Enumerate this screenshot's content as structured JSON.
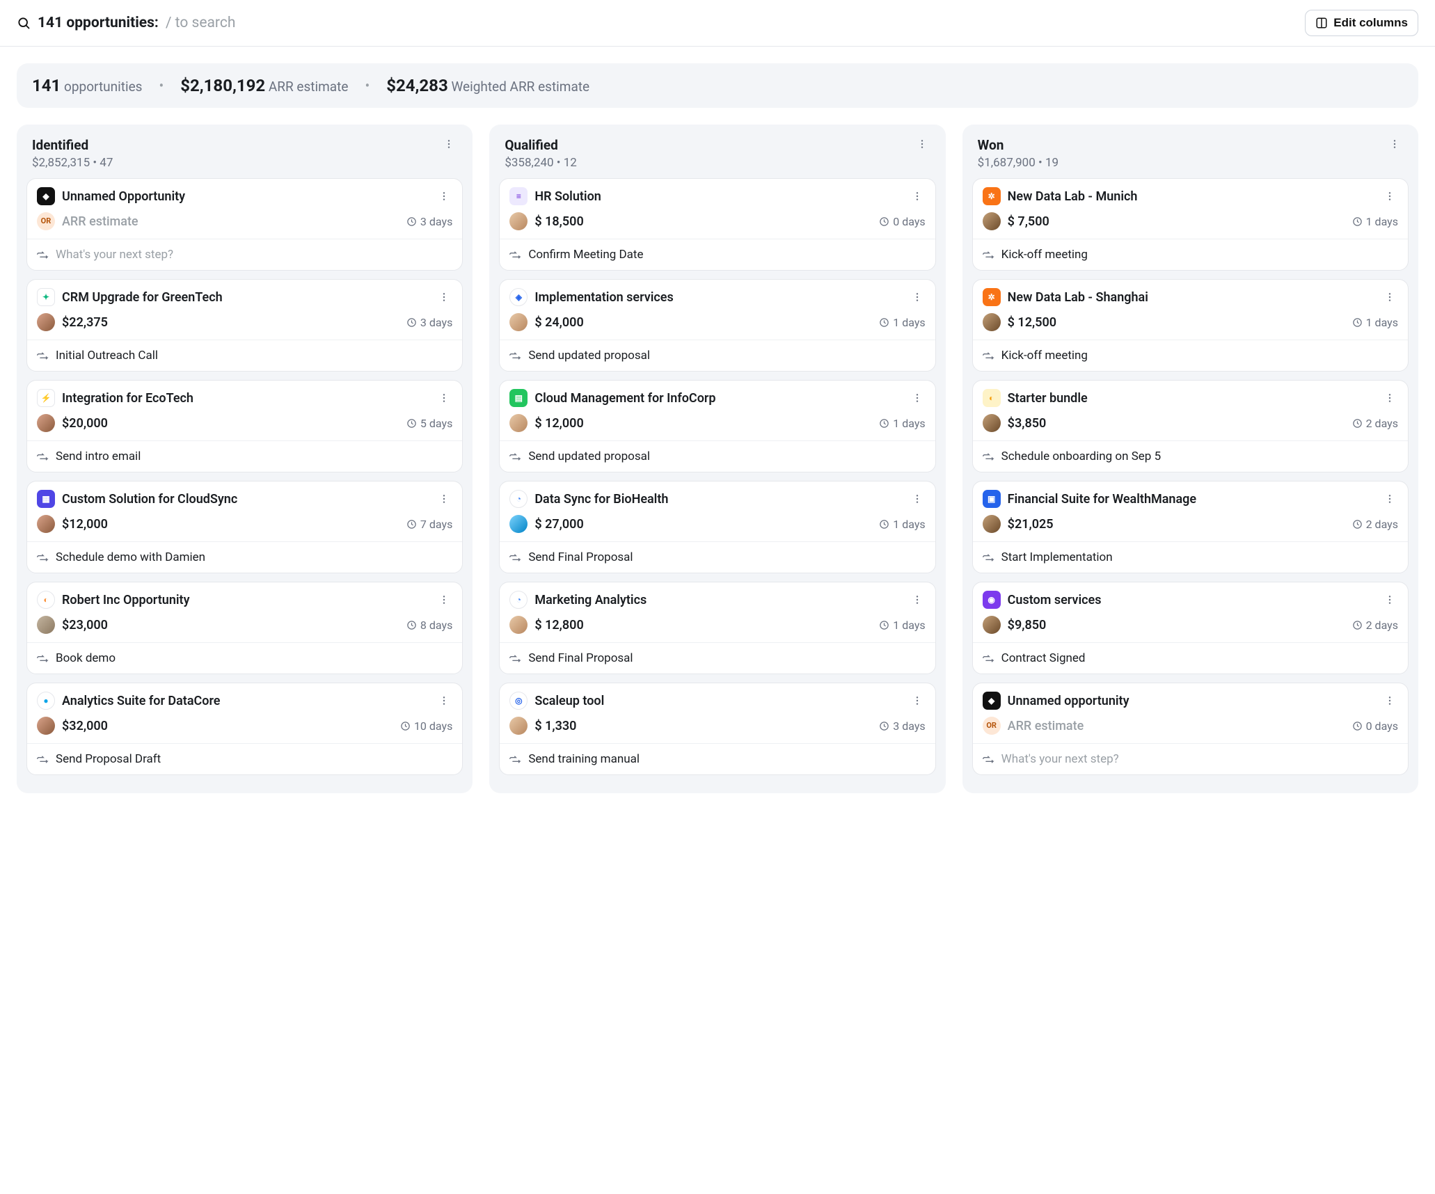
{
  "search": {
    "count_label": "141 opportunities:",
    "hint": "/ to search"
  },
  "edit_columns_label": "Edit columns",
  "stats": {
    "count_value": "141",
    "count_label": "opportunities",
    "arr_value": "$2,180,192",
    "arr_label": "ARR estimate",
    "warr_value": "$24,283",
    "warr_label": "Weighted ARR estimate"
  },
  "columns": [
    {
      "title": "Identified",
      "subtotal": "$2,852,315",
      "count": "47",
      "cards": [
        {
          "logo_bg": "#111111",
          "logo_txt": "◆",
          "logo_round": false,
          "title": "Unnamed Opportunity",
          "avatar": null,
          "or": true,
          "amount": "ARR estimate",
          "amount_ph": true,
          "days": "3 days",
          "next": "What's your next step?",
          "next_ph": true
        },
        {
          "logo_bg": "#ffffff",
          "logo_txt": "✦",
          "logo_fg": "#10b981",
          "logo_round": false,
          "logo_border": true,
          "title": "CRM Upgrade for GreenTech",
          "avatar": "linear-gradient(135deg,#d9a38a,#8b5a3c)",
          "or": false,
          "amount": "$22,375",
          "amount_ph": false,
          "days": "3 days",
          "next": "Initial Outreach Call",
          "next_ph": false
        },
        {
          "logo_bg": "#ffffff",
          "logo_txt": "⚡",
          "logo_fg": "#10b981",
          "logo_round": false,
          "logo_border": true,
          "title": "Integration for EcoTech",
          "avatar": "linear-gradient(135deg,#d9a38a,#8b5a3c)",
          "or": false,
          "amount": "$20,000",
          "amount_ph": false,
          "days": "5 days",
          "next": "Send intro email",
          "next_ph": false
        },
        {
          "logo_bg": "#4f46e5",
          "logo_txt": "▦",
          "logo_round": false,
          "title": "Custom Solution for CloudSync",
          "avatar": "linear-gradient(135deg,#d9a38a,#8b5a3c)",
          "or": false,
          "amount": "$12,000",
          "amount_ph": false,
          "days": "7 days",
          "next": "Schedule demo with Damien",
          "next_ph": false
        },
        {
          "logo_bg": "#ffffff",
          "logo_txt": "◐",
          "logo_fg": "#fb923c",
          "logo_round": true,
          "logo_border": true,
          "title": "Robert Inc Opportunity",
          "avatar": "linear-gradient(135deg,#c4b5a0,#8b7860)",
          "or": false,
          "amount": "$23,000",
          "amount_ph": false,
          "days": "8 days",
          "next": "Book demo",
          "next_ph": false
        },
        {
          "logo_bg": "#ffffff",
          "logo_txt": "●",
          "logo_fg": "#0ea5e9",
          "logo_round": true,
          "logo_border": true,
          "title": "Analytics Suite for DataCore",
          "avatar": "linear-gradient(135deg,#d9a38a,#8b5a3c)",
          "or": false,
          "amount": "$32,000",
          "amount_ph": false,
          "days": "10 days",
          "next": "Send Proposal Draft",
          "next_ph": false
        }
      ]
    },
    {
      "title": "Qualified",
      "subtotal": "$358,240",
      "count": "12",
      "cards": [
        {
          "logo_bg": "#ede9fe",
          "logo_txt": "≡",
          "logo_fg": "#6d28d9",
          "logo_round": false,
          "title": "HR Solution",
          "avatar": "linear-gradient(135deg,#e8c9a8,#b8875f)",
          "or": false,
          "amount": "$ 18,500",
          "amount_ph": false,
          "days": "0 days",
          "next": "Confirm Meeting Date",
          "next_ph": false
        },
        {
          "logo_bg": "#ffffff",
          "logo_txt": "◈",
          "logo_fg": "#2563eb",
          "logo_round": true,
          "logo_border": true,
          "title": "Implementation services",
          "avatar": "linear-gradient(135deg,#e8c9a8,#b8875f)",
          "or": false,
          "amount": "$ 24,000",
          "amount_ph": false,
          "days": "1 days",
          "next": "Send updated proposal",
          "next_ph": false
        },
        {
          "logo_bg": "#22c55e",
          "logo_txt": "▤",
          "logo_round": false,
          "title": "Cloud Management for InfoCorp",
          "avatar": "linear-gradient(135deg,#e8c9a8,#b8875f)",
          "or": false,
          "amount": "$ 12,000",
          "amount_ph": false,
          "days": "1 days",
          "next": "Send updated proposal",
          "next_ph": false
        },
        {
          "logo_bg": "#ffffff",
          "logo_txt": "◔",
          "logo_fg": "#3b82f6",
          "logo_round": true,
          "logo_border": true,
          "title": "Data Sync for BioHealth",
          "avatar": "linear-gradient(135deg,#7dd3fc,#0284c7)",
          "or": false,
          "amount": "$ 27,000",
          "amount_ph": false,
          "days": "1 days",
          "next": "Send Final Proposal",
          "next_ph": false
        },
        {
          "logo_bg": "#ffffff",
          "logo_txt": "◔",
          "logo_fg": "#3b82f6",
          "logo_round": true,
          "logo_border": true,
          "title": " Marketing Analytics",
          "avatar": "linear-gradient(135deg,#e8c9a8,#b8875f)",
          "or": false,
          "amount": "$ 12,800",
          "amount_ph": false,
          "days": "1 days",
          "next": "Send Final Proposal",
          "next_ph": false
        },
        {
          "logo_bg": "#ffffff",
          "logo_txt": "◎",
          "logo_fg": "#2563eb",
          "logo_round": true,
          "logo_border": true,
          "title": "Scaleup tool",
          "avatar": "linear-gradient(135deg,#e8c9a8,#b8875f)",
          "or": false,
          "amount": "$ 1,330",
          "amount_ph": false,
          "days": "3 days",
          "next": "Send training manual",
          "next_ph": false
        }
      ]
    },
    {
      "title": "Won",
      "subtotal": "$1,687,900",
      "count": "19",
      "cards": [
        {
          "logo_bg": "#f97316",
          "logo_txt": "✲",
          "logo_round": false,
          "title": "New Data Lab - Munich",
          "avatar": "linear-gradient(135deg,#c4a078,#6b4a2a)",
          "or": false,
          "amount": "$ 7,500",
          "amount_ph": false,
          "days": "1 days",
          "next": "Kick-off meeting",
          "next_ph": false
        },
        {
          "logo_bg": "#f97316",
          "logo_txt": "✲",
          "logo_round": false,
          "title": "New Data Lab - Shanghai",
          "avatar": "linear-gradient(135deg,#c4a078,#6b4a2a)",
          "or": false,
          "amount": "$ 12,500",
          "amount_ph": false,
          "days": "1 days",
          "next": "Kick-off meeting",
          "next_ph": false
        },
        {
          "logo_bg": "#fef3c7",
          "logo_txt": "◐",
          "logo_fg": "#f59e0b",
          "logo_round": false,
          "title": "Starter bundle",
          "avatar": "linear-gradient(135deg,#c4a078,#6b4a2a)",
          "or": false,
          "amount": "$3,850",
          "amount_ph": false,
          "days": "2 days",
          "next": "Schedule onboarding on Sep 5",
          "next_ph": false
        },
        {
          "logo_bg": "#2563eb",
          "logo_txt": "▣",
          "logo_round": false,
          "title": "Financial Suite for WealthManage",
          "avatar": "linear-gradient(135deg,#c4a078,#6b4a2a)",
          "or": false,
          "amount": "$21,025",
          "amount_ph": false,
          "days": "2 days",
          "next": "Start Implementation",
          "next_ph": false
        },
        {
          "logo_bg": "#7c3aed",
          "logo_txt": "◉",
          "logo_round": false,
          "title": "Custom services",
          "avatar": "linear-gradient(135deg,#c4a078,#6b4a2a)",
          "or": false,
          "amount": "$9,850",
          "amount_ph": false,
          "days": "2 days",
          "next": "Contract Signed",
          "next_ph": false
        },
        {
          "logo_bg": "#111111",
          "logo_txt": "◆",
          "logo_round": false,
          "title": "Unnamed opportunity",
          "avatar": null,
          "or": true,
          "amount": "ARR estimate",
          "amount_ph": true,
          "days": "0 days",
          "next": "What's your next step?",
          "next_ph": true
        }
      ]
    }
  ]
}
